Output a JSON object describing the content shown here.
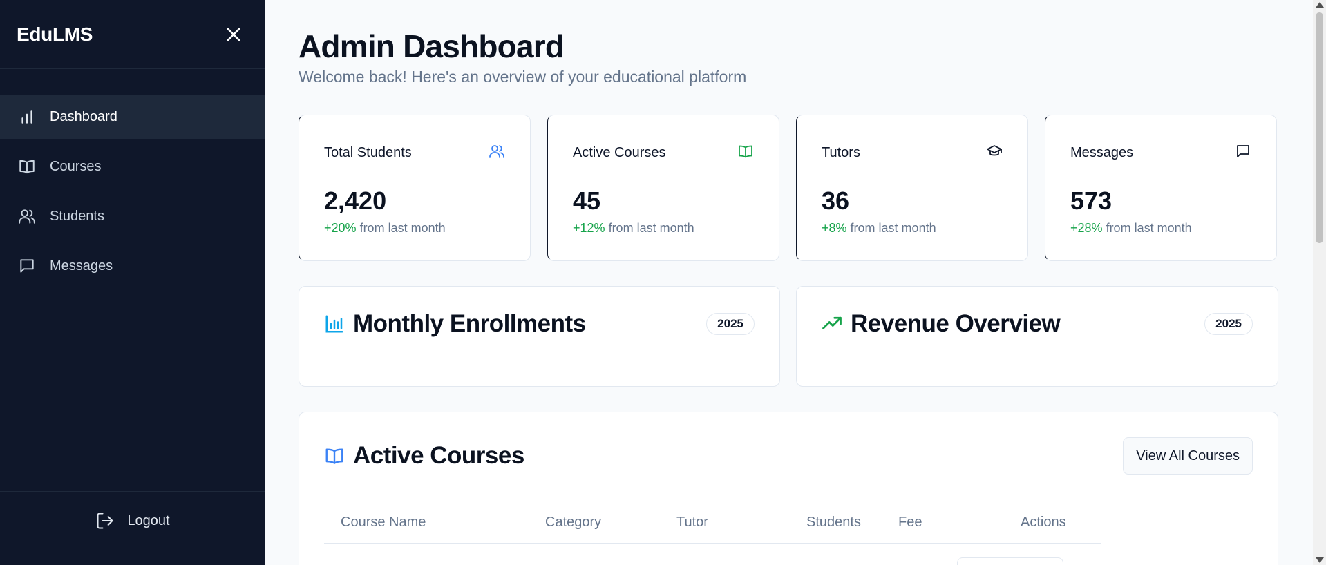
{
  "sidebar": {
    "brand": "EduLMS",
    "items": [
      {
        "label": "Dashboard",
        "icon": "bar-chart-icon",
        "active": true
      },
      {
        "label": "Courses",
        "icon": "book-icon",
        "active": false
      },
      {
        "label": "Students",
        "icon": "users-icon",
        "active": false
      },
      {
        "label": "Messages",
        "icon": "message-icon",
        "active": false
      }
    ],
    "logout_label": "Logout"
  },
  "header": {
    "title": "Admin Dashboard",
    "subtitle": "Welcome back! Here's an overview of your educational platform"
  },
  "stats": [
    {
      "title": "Total Students",
      "value": "2,420",
      "change": "+20%",
      "change_suffix": "from last month",
      "icon": "users-icon",
      "icon_color": "#3b82f6"
    },
    {
      "title": "Active Courses",
      "value": "45",
      "change": "+12%",
      "change_suffix": "from last month",
      "icon": "book-icon",
      "icon_color": "#16a34a"
    },
    {
      "title": "Tutors",
      "value": "36",
      "change": "+8%",
      "change_suffix": "from last month",
      "icon": "graduation-cap-icon",
      "icon_color": "#0f172a"
    },
    {
      "title": "Messages",
      "value": "573",
      "change": "+28%",
      "change_suffix": "from last month",
      "icon": "message-icon",
      "icon_color": "#0f172a"
    }
  ],
  "charts": [
    {
      "title": "Monthly Enrollments",
      "year": "2025",
      "icon": "bar-chart-icon",
      "icon_color": "#0ea5e9"
    },
    {
      "title": "Revenue Overview",
      "year": "2025",
      "icon": "trending-up-icon",
      "icon_color": "#16a34a"
    }
  ],
  "courses": {
    "title": "Active Courses",
    "icon": "book-icon",
    "icon_color": "#3b82f6",
    "view_all_label": "View All Courses",
    "columns": [
      "Course Name",
      "Category",
      "Tutor",
      "Students",
      "Fee",
      "Actions"
    ]
  },
  "colors": {
    "sidebar_bg": "#0f172a",
    "accent_positive": "#16a34a",
    "accent_blue": "#3b82f6"
  }
}
